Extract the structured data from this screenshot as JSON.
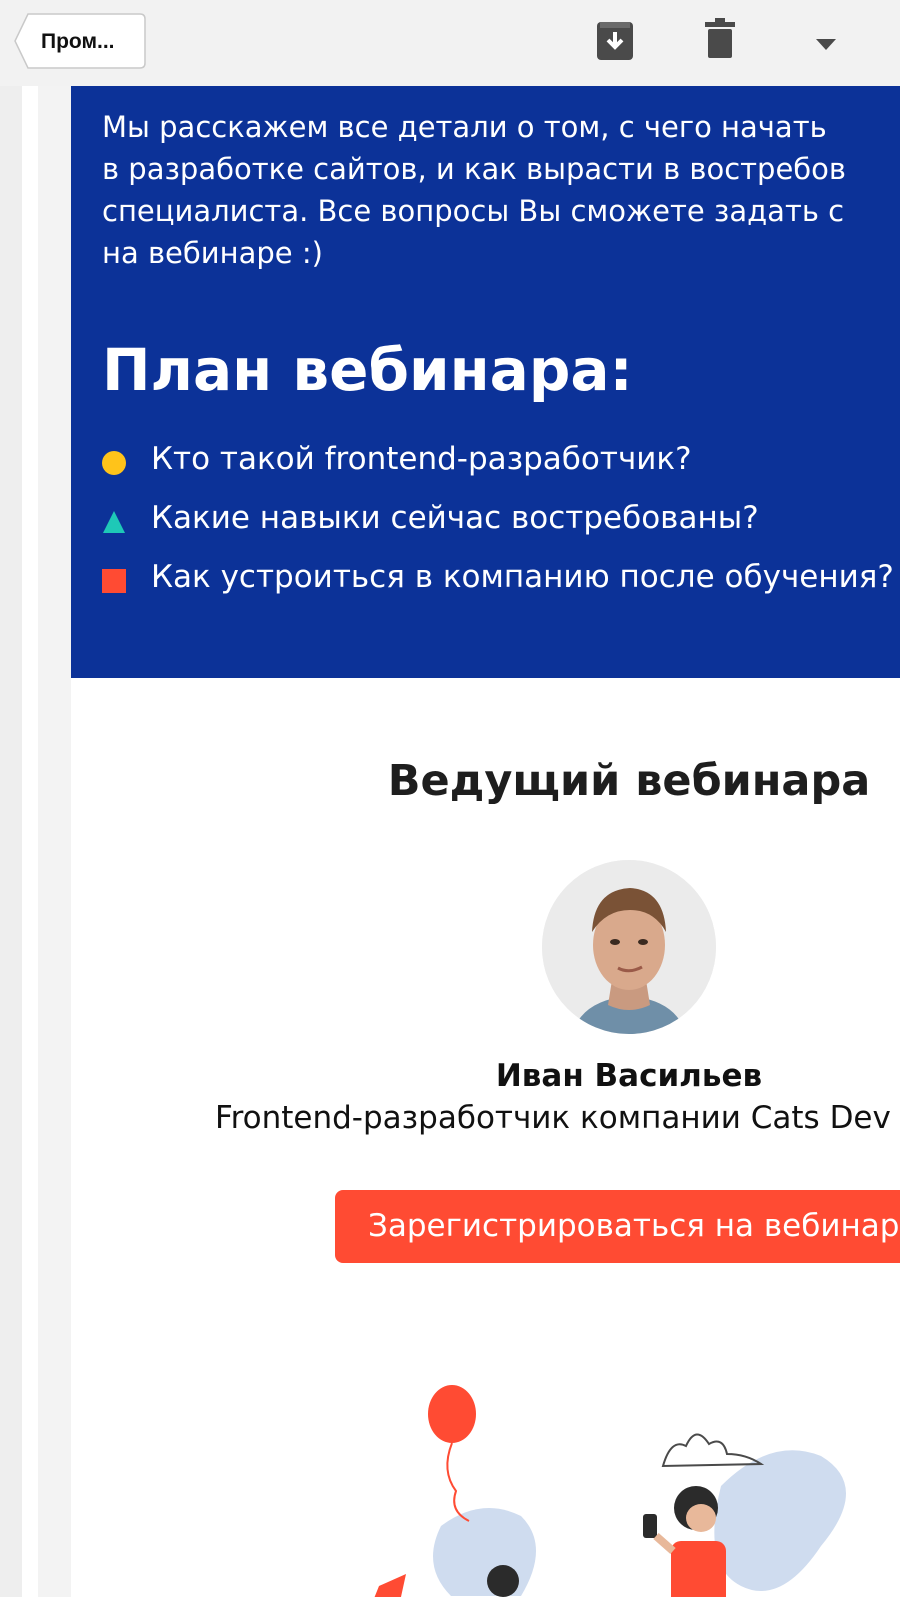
{
  "toolbar": {
    "back_label": "Пром...",
    "icons": [
      "archive-icon",
      "trash-icon",
      "chevron-down-icon"
    ]
  },
  "email": {
    "intro_lines": [
      "Мы расскажем все детали о том, с чего начать",
      "в разработке сайтов, и как вырасти в востребов",
      "специалиста. Все вопросы Вы сможете задать с",
      "на вебинаре :)"
    ],
    "plan_title": "План вебинара:",
    "plan_items": [
      {
        "marker": "circle",
        "color": "#ffc31a",
        "text": "Кто такой frontend-разработчик?"
      },
      {
        "marker": "triangle",
        "color": "#1ec8b7",
        "text": "Какие навыки сейчас востребованы?"
      },
      {
        "marker": "square",
        "color": "#ff4b33",
        "text": "Как устроиться в компанию после обучения?"
      }
    ],
    "host_title": "Ведущий вебинара",
    "host_name": "Иван Васильев",
    "host_role": "Frontend-разработчик компании Cats Dev",
    "cta_label": "Зарегистрироваться на вебинар"
  },
  "colors": {
    "blue_bg": "#0c3298",
    "accent_red": "#ff4b33",
    "accent_yellow": "#ffc31a",
    "accent_teal": "#1ec8b7"
  }
}
